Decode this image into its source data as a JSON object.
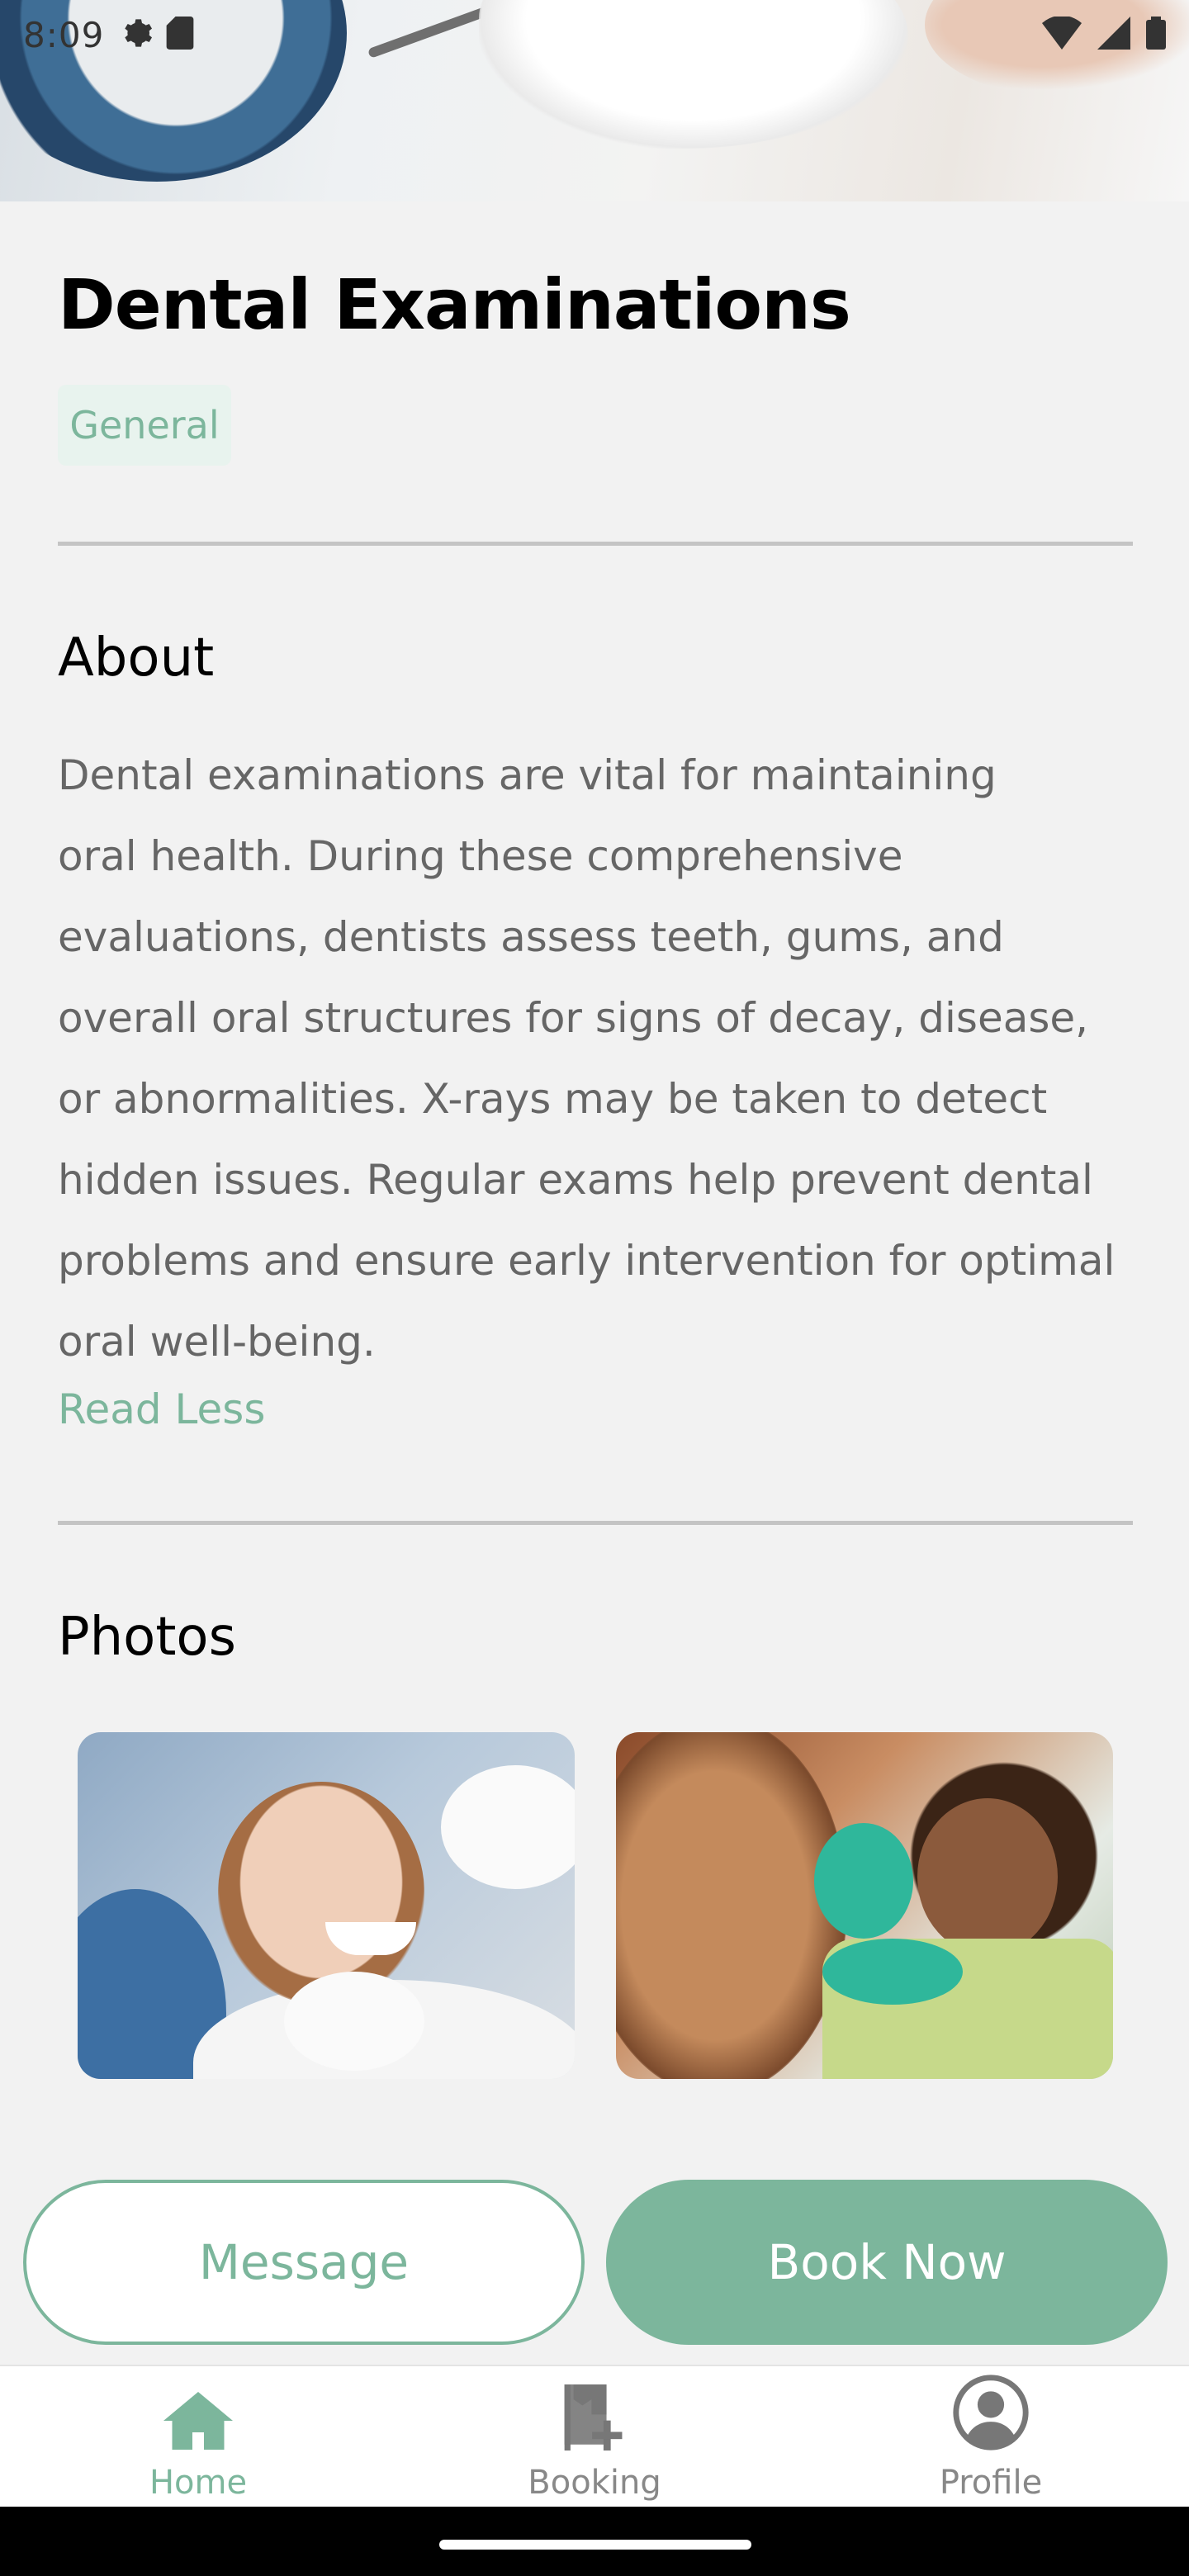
{
  "status_bar": {
    "time": "8:09",
    "icons": [
      "gear-icon",
      "sd-card-icon",
      "wifi-icon",
      "signal-icon",
      "battery-icon"
    ]
  },
  "service": {
    "title": "Dental Examinations",
    "category": "General"
  },
  "about": {
    "heading": "About",
    "lines": [
      "Dental examinations are vital for maintaining",
      "oral health. During these comprehensive",
      "evaluations, dentists assess teeth, gums, and",
      "overall oral structures for signs of decay, disease,",
      "or abnormalities. X-rays may be taken to detect",
      "hidden issues. Regular exams help prevent dental",
      "problems and ensure early intervention for optimal",
      "oral well-being."
    ],
    "toggle_label": "Read Less"
  },
  "photos": {
    "heading": "Photos"
  },
  "actions": {
    "message_label": "Message",
    "book_label": "Book Now"
  },
  "nav": {
    "items": [
      {
        "label": "Home",
        "icon": "home-icon",
        "active": true
      },
      {
        "label": "Booking",
        "icon": "booking-icon",
        "active": false
      },
      {
        "label": "Profile",
        "icon": "profile-icon",
        "active": false
      }
    ]
  },
  "colors": {
    "accent": "#7cb69c",
    "tag_bg": "#e8f3ee",
    "body_text": "#666666",
    "background": "#f2f2f2"
  }
}
